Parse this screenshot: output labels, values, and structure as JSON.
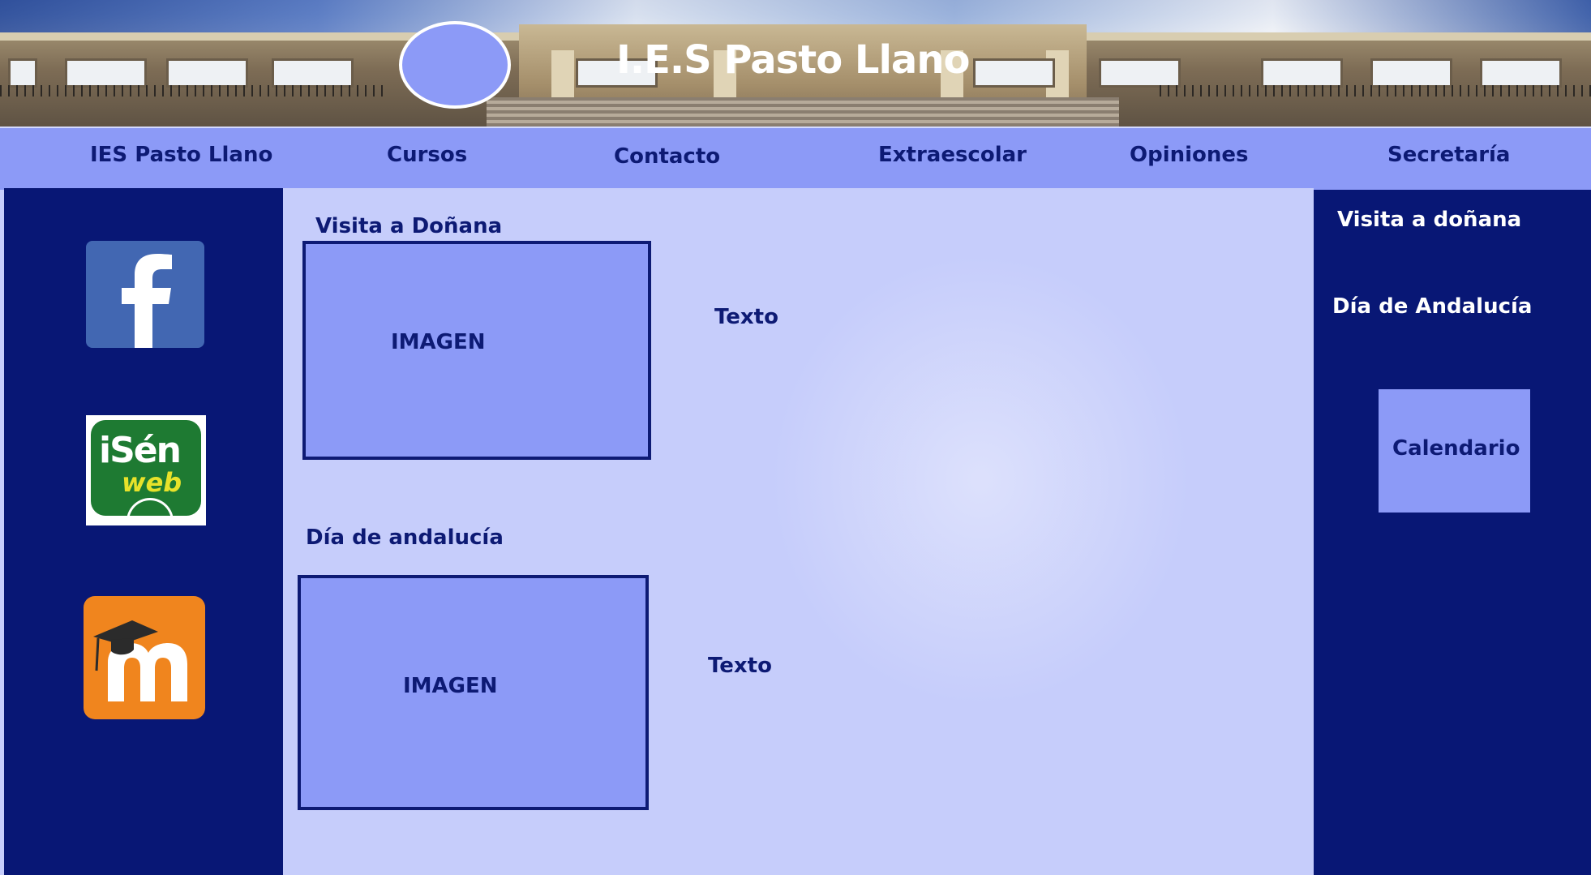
{
  "header": {
    "title": "I.E.S Pasto Llano"
  },
  "nav": {
    "items": [
      {
        "label": "IES Pasto Llano"
      },
      {
        "label": "Cursos"
      },
      {
        "label": "Contacto"
      },
      {
        "label": "Extraescolar"
      },
      {
        "label": "Opiniones"
      },
      {
        "label": "Secretaría"
      }
    ]
  },
  "left_sidebar": {
    "icons": [
      "facebook-icon",
      "isenweb-icon",
      "moodle-icon"
    ],
    "isen": {
      "line1": "iSén",
      "line2": "web"
    }
  },
  "main": {
    "sections": [
      {
        "title": "Visita a Doñana",
        "image_label": "IMAGEN",
        "text": "Texto"
      },
      {
        "title": "Día de andalucía",
        "image_label": "IMAGEN",
        "text": "Texto"
      }
    ]
  },
  "right_sidebar": {
    "links": [
      {
        "label": "Visita a doñana"
      },
      {
        "label": "Día de Andalucía"
      }
    ],
    "calendar_label": "Calendario"
  },
  "colors": {
    "dark_navy": "#081775",
    "nav_periwinkle": "#8c9af7",
    "content_background": "#c6cdfb",
    "text_navy": "#0d1a74"
  }
}
